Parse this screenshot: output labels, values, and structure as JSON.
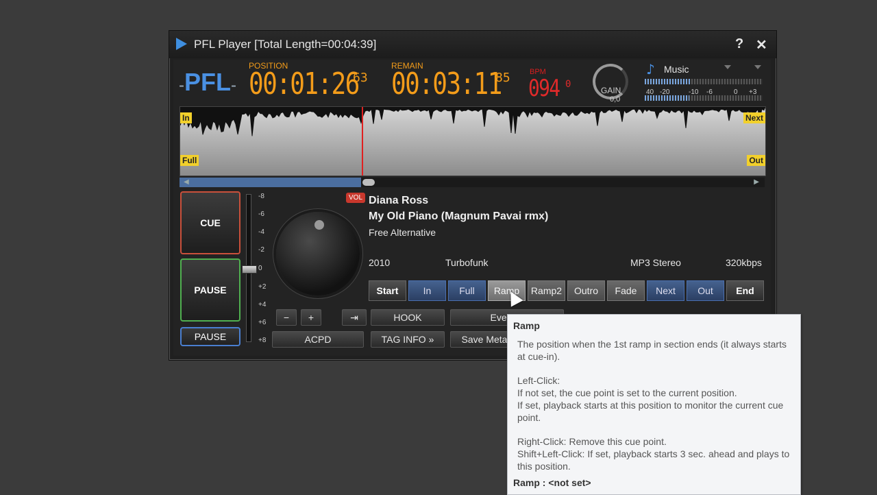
{
  "window": {
    "title": "PFL Player [Total Length=00:04:39]",
    "help_label": "?",
    "close_label": "✕"
  },
  "header": {
    "logo": "PFL",
    "logo_dash": "-",
    "position_label": "POSITION",
    "position_value": "00:01:26",
    "position_frac": "63",
    "remain_label": "REMAIN",
    "remain_value": "00:03:11",
    "remain_frac": "85",
    "bpm_label": "BPM",
    "bpm_value": "094",
    "bpm_frac": "0",
    "gain_label": "GAIN",
    "gain_value": "0,0",
    "music_label": "Music",
    "meter_scale": [
      "40",
      "-20",
      "-10",
      "-6",
      "0",
      "+3"
    ],
    "meter_levels": [
      0.39,
      0.38
    ]
  },
  "waveform": {
    "tag_in": "In",
    "tag_full": "Full",
    "tag_next": "Next",
    "tag_out": "Out",
    "progress": 0.31
  },
  "deck": {
    "cue_label": "CUE",
    "pause_label": "PAUSE",
    "pause_small_label": "PAUSE",
    "scale": [
      "-8",
      "-6",
      "-4",
      "-2",
      "0",
      "+2",
      "+4",
      "+6",
      "+8"
    ],
    "vol_badge": "VOL",
    "minus_label": "−",
    "plus_label": "+",
    "jump_label": "⇥"
  },
  "track": {
    "artist": "Diana Ross",
    "title": "My Old Piano (Magnum Pavai rmx)",
    "album": "Free Alternative",
    "year": "2010",
    "genre": "Turbofunk",
    "format": "MP3 Stereo",
    "bitrate": "320kbps"
  },
  "cue_buttons": [
    "Start",
    "In",
    "Full",
    "Ramp",
    "Ramp2",
    "Outro",
    "Fade",
    "Next",
    "Out",
    "End"
  ],
  "bottom_buttons": {
    "hook": "HOOK",
    "event": "Event E",
    "acpd": "ACPD",
    "tag_info": "TAG INFO »",
    "save_meta": "Save Meta"
  },
  "tooltip": {
    "title": "Ramp",
    "desc": "The position when the 1st ramp in section ends (it always starts at cue-in).",
    "left_click_head": "Left-Click:",
    "left_click_1": "If not set, the cue point is set to the current position.",
    "left_click_2": "If set, playback starts at this position to monitor the current cue point.",
    "right_click": "Right-Click: Remove this cue point.",
    "shift_click": "Shift+Left-Click: If set, playback starts 3 sec. ahead and plays to this position.",
    "footer": "Ramp : <not set>"
  }
}
